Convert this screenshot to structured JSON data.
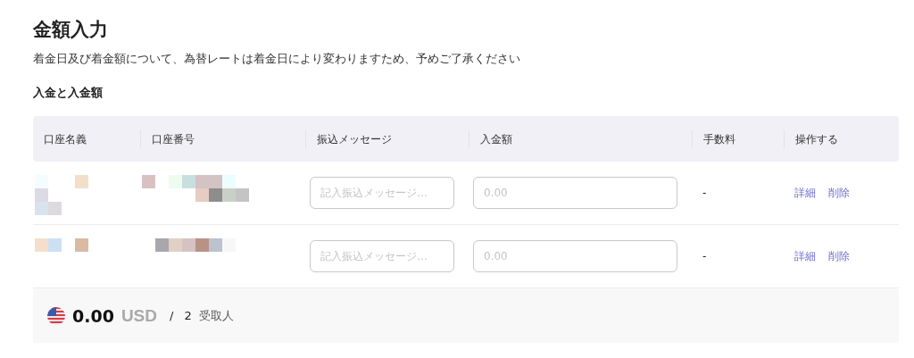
{
  "title": "金額入力",
  "notice": "着金日及び着金額について、為替レートは着金日により変わりますため、予めご了承ください",
  "section_title": "入金と入金額",
  "table": {
    "columns": [
      "口座名義",
      "口座番号",
      "振込メッセージ",
      "入金額",
      "手数料",
      "操作する"
    ],
    "rows": [
      {
        "message": {
          "placeholder": "記入振込メッセージ…"
        },
        "amount": {
          "placeholder": "0.00"
        },
        "fee": "-",
        "actions": [
          "詳細",
          "削除"
        ]
      },
      {
        "message": {
          "placeholder": "記入振込メッセージ…"
        },
        "amount": {
          "placeholder": "0.00"
        },
        "fee": "-",
        "actions": [
          "詳細",
          "削除"
        ]
      }
    ]
  },
  "summary": {
    "total": "0.00",
    "currency": "USD",
    "separator": "/",
    "count": "2",
    "count_label": "受取人"
  }
}
